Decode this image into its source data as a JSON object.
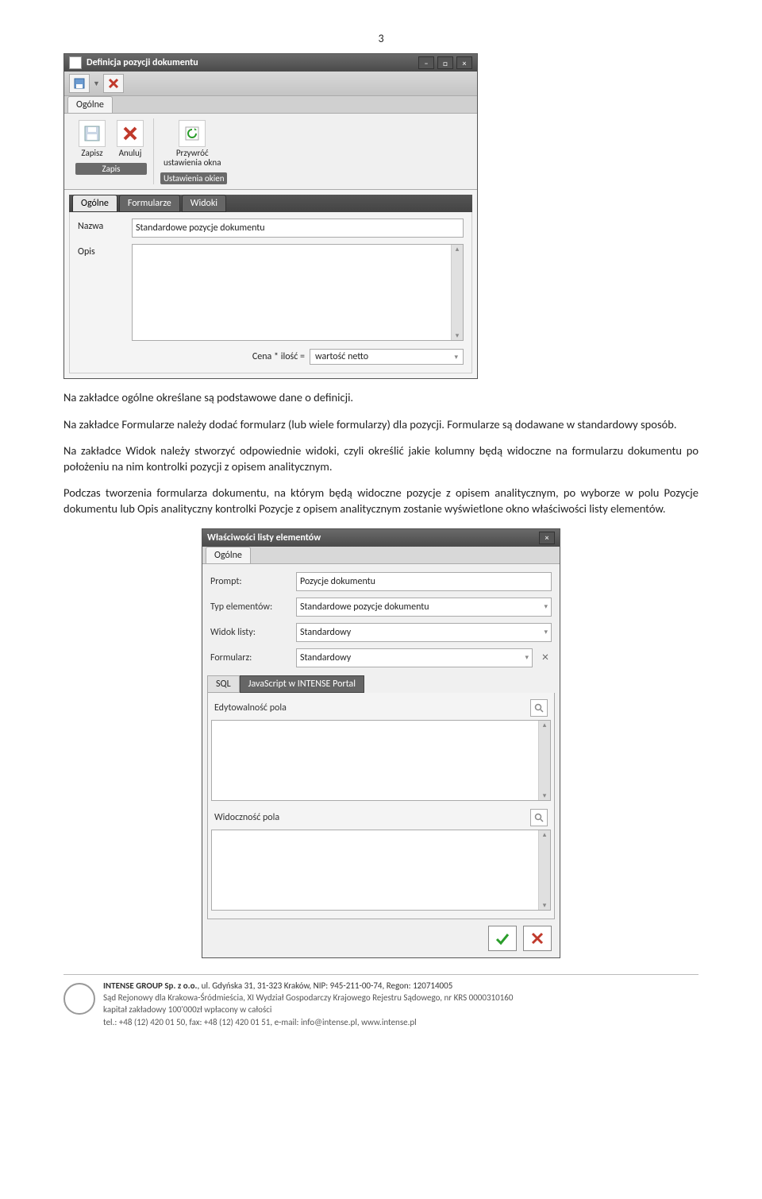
{
  "page_number": "3",
  "win1": {
    "title": "Definicja pozycji dokumentu",
    "ribbon_tab": "Ogólne",
    "btn_save": "Zapisz",
    "btn_cancel": "Anuluj",
    "btn_restore_l1": "Przywróć",
    "btn_restore_l2": "ustawienia okna",
    "group_save": "Zapis",
    "group_windows": "Ustawienia okien",
    "subtab_general": "Ogólne",
    "subtab_forms": "Formularze",
    "subtab_views": "Widoki",
    "label_name": "Nazwa",
    "value_name": "Standardowe pozycje dokumentu",
    "label_desc": "Opis",
    "formula_label": "Cena * ilość =",
    "formula_value": "wartość netto"
  },
  "para1": "Na zakładce ogólne określane są podstawowe dane o definicji.",
  "para2": "Na zakładce Formularze należy dodać formularz (lub wiele formularzy) dla pozycji. Formularze są dodawane w standardowy sposób.",
  "para3": "Na zakładce Widok należy stworzyć odpowiednie widoki, czyli określić jakie kolumny będą widoczne na formularzu dokumentu po położeniu na nim kontrolki pozycji z opisem analitycznym.",
  "para4": "Podczas tworzenia formularza dokumentu, na którym będą widoczne pozycje z opisem analitycznym, po wyborze w polu Pozycje dokumentu lub Opis analityczny kontrolki Pozycje z opisem analitycznym zostanie wyświetlone okno właściwości listy elementów.",
  "win2": {
    "title": "Właściwości listy elementów",
    "tab_general": "Ogólne",
    "l_prompt": "Prompt:",
    "v_prompt": "Pozycje dokumentu",
    "l_type": "Typ elementów:",
    "v_type": "Standardowe pozycje dokumentu",
    "l_view": "Widok listy:",
    "v_view": "Standardowy",
    "l_form": "Formularz:",
    "v_form": "Standardowy",
    "tab_sql": "SQL",
    "tab_js": "JavaScript w INTENSE Portal",
    "sec_edit": "Edytowalność pola",
    "sec_vis": "Widoczność pola"
  },
  "footer": {
    "bold": "INTENSE GROUP  Sp. z o.o.",
    "rest1": ", ul. Gdyńska 31, 31-323 Kraków, NIP: 945-211-00-74, Regon: 120714005",
    "l2": "Sąd Rejonowy dla Krakowa-Śródmieścia, XI Wydział Gospodarczy Krajowego Rejestru Sądowego, nr KRS 0000310160",
    "l3": "kapitał zakładowy 100'000zł wpłacony w całości",
    "l4": "tel.: +48 (12) 420 01 50, fax: +48 (12) 420 01 51, e-mail: info@intense.pl, www.intense.pl"
  }
}
